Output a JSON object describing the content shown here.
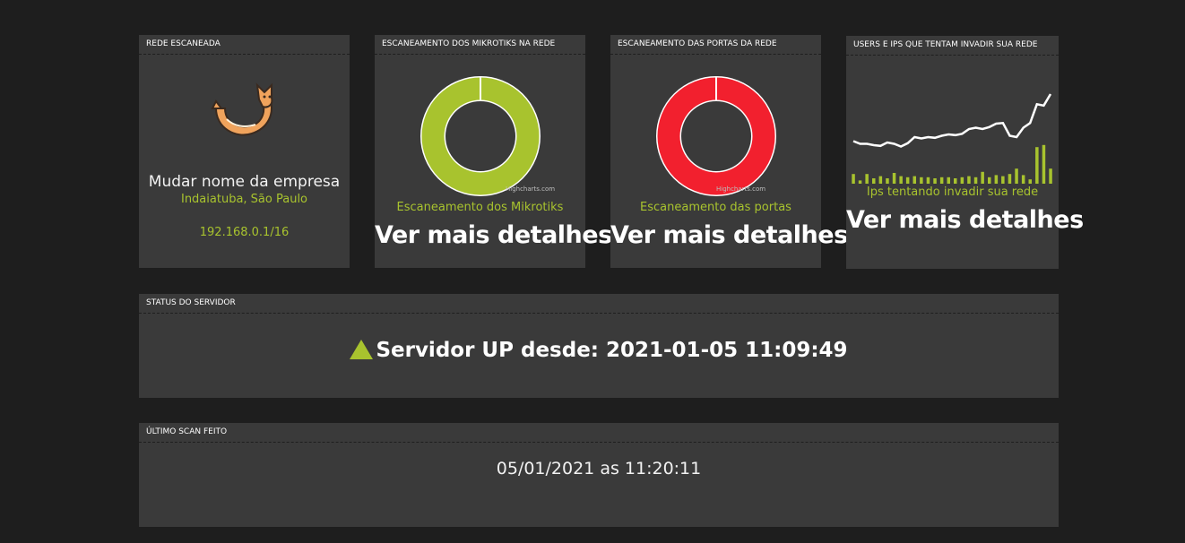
{
  "panels": {
    "rede": {
      "title": "REDE ESCANEADA",
      "company_name": "Mudar nome da empresa",
      "location": "Indaiatuba, São Paulo",
      "ip": "192.168.0.1/16",
      "logo_icon": "fox-logo-icon"
    },
    "mikrotiks": {
      "title": "ESCANEAMENTO DOS MIKROTIKS NA REDE",
      "caption": "Escaneamento dos Mikrotiks",
      "link": "Ver mais detalhes",
      "credit": "Highcharts.com",
      "color": "#a8c32e"
    },
    "portas": {
      "title": "ESCANEAMENTO DAS PORTAS DA REDE",
      "caption": "Escaneamento das portas",
      "link": "Ver mais detalhes",
      "credit": "Highcharts.com",
      "color": "#f2202e"
    },
    "invasores": {
      "title": "USERS E IPS QUE TENTAM INVADIR SUA REDE",
      "caption": "Ips tentando invadir sua rede",
      "link": "Ver mais detalhes"
    },
    "status": {
      "title": "STATUS DO SERVIDOR",
      "text": "Servidor UP desde: 2021-01-05 11:09:49",
      "icon": "up-triangle-icon"
    },
    "ultimo_scan": {
      "title": "ÚLTIMO SCAN FEITO",
      "text": "05/01/2021 as 11:20:11"
    }
  },
  "chart_data": [
    {
      "type": "pie",
      "values": [
        100
      ],
      "colors": [
        "#a8c32e"
      ]
    },
    {
      "type": "pie",
      "values": [
        100
      ],
      "colors": [
        "#f2202e"
      ]
    },
    {
      "type": "line",
      "x": [
        0,
        1,
        2,
        3,
        4,
        5,
        6,
        7,
        8,
        9,
        10,
        11,
        12,
        13,
        14,
        15,
        16,
        17,
        18,
        19,
        20,
        21,
        22,
        23,
        24,
        25,
        26,
        27
      ],
      "series": [
        {
          "values": [
            30,
            26,
            26,
            24,
            23,
            28,
            26,
            22,
            27,
            36,
            34,
            36,
            35,
            38,
            40,
            39,
            41,
            48,
            50,
            48,
            51,
            56,
            57,
            38,
            36,
            50,
            57,
            85,
            83,
            100
          ]
        },
        {
          "values": [
            18,
            6,
            18,
            10,
            14,
            10,
            20,
            14,
            12,
            14,
            12,
            12,
            10,
            12,
            12,
            10,
            12,
            14,
            12,
            22,
            12,
            16,
            14,
            18,
            28,
            16,
            8,
            68,
            72,
            28
          ]
        }
      ],
      "colors": [
        "#ffffff",
        "#a8c32e"
      ]
    }
  ]
}
